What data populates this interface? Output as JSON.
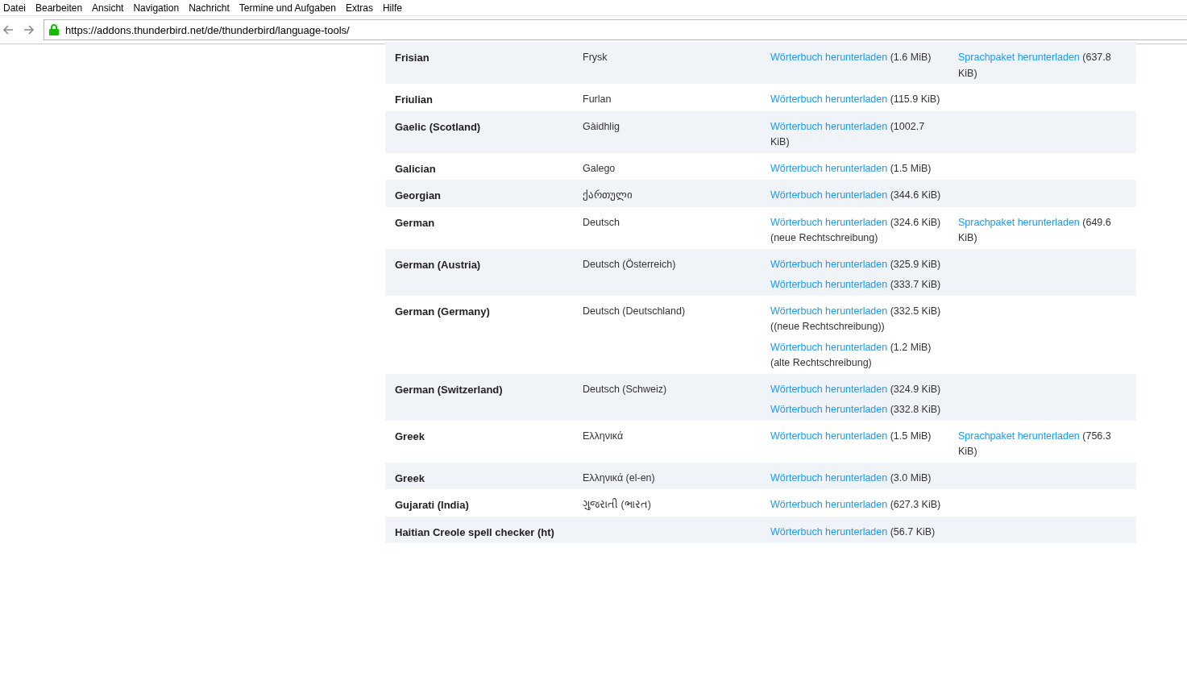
{
  "menu": [
    {
      "label": "Datei"
    },
    {
      "label": "Bearbeiten"
    },
    {
      "label": "Ansicht"
    },
    {
      "label": "Navigation"
    },
    {
      "label": "Nachricht"
    },
    {
      "label": "Termine und Aufgaben"
    },
    {
      "label": "Extras"
    },
    {
      "label": "Hilfe"
    }
  ],
  "address_bar": {
    "url": "https://addons.thunderbird.net/de/thunderbird/language-tools/",
    "secure": true
  },
  "table": {
    "rows": [
      {
        "language": "Frisian",
        "native": "Frysk",
        "dictionaries": [
          {
            "link": "Wörterbuch herunterladen",
            "size": "(1.6 MiB)"
          }
        ],
        "language_pack": {
          "link": "Sprachpaket herunterladen",
          "size": "(637.8 KiB)"
        }
      },
      {
        "language": "Friulian",
        "native": "Furlan",
        "dictionaries": [
          {
            "link": "Wörterbuch herunterladen",
            "size": "(115.9 KiB)"
          }
        ]
      },
      {
        "language": "Gaelic (Scotland)",
        "native": "Gàidhlig",
        "dictionaries": [
          {
            "link": "Wörterbuch herunterladen",
            "size": "(1002.7 KiB)"
          }
        ]
      },
      {
        "language": "Galician",
        "native": "Galego",
        "dictionaries": [
          {
            "link": "Wörterbuch herunterladen",
            "size": "(1.5 MiB)"
          }
        ]
      },
      {
        "language": "Georgian",
        "native": "ქართული",
        "dictionaries": [
          {
            "link": "Wörterbuch herunterladen",
            "size": "(344.6 KiB)"
          }
        ]
      },
      {
        "language": "German",
        "native": "Deutsch",
        "dictionaries": [
          {
            "link": "Wörterbuch herunterladen",
            "size": "(324.6 KiB)",
            "note": "(neue Rechtschreibung)"
          }
        ],
        "language_pack": {
          "link": "Sprachpaket herunterladen",
          "size": "(649.6 KiB)"
        }
      },
      {
        "language": "German (Austria)",
        "native": "Deutsch (Österreich)",
        "dictionaries": [
          {
            "link": "Wörterbuch herunterladen",
            "size": "(325.9 KiB)"
          },
          {
            "link": "Wörterbuch herunterladen",
            "size": "(333.7 KiB)"
          }
        ]
      },
      {
        "language": "German (Germany)",
        "native": "Deutsch (Deutschland)",
        "dictionaries": [
          {
            "link": "Wörterbuch herunterladen",
            "size": "(332.5 KiB)",
            "note": "((neue Rechtschreibung))"
          },
          {
            "link": "Wörterbuch herunterladen",
            "size": "(1.2 MiB)",
            "note": "(alte Rechtschreibung)"
          }
        ]
      },
      {
        "language": "German (Switzerland)",
        "native": "Deutsch (Schweiz)",
        "dictionaries": [
          {
            "link": "Wörterbuch herunterladen",
            "size": "(324.9 KiB)"
          },
          {
            "link": "Wörterbuch herunterladen",
            "size": "(332.8 KiB)"
          }
        ]
      },
      {
        "language": "Greek",
        "native": "Ελληνικά",
        "dictionaries": [
          {
            "link": "Wörterbuch herunterladen",
            "size": "(1.5 MiB)"
          }
        ],
        "language_pack": {
          "link": "Sprachpaket herunterladen",
          "size": "(756.3 KiB)"
        }
      },
      {
        "language": "Greek",
        "native": "Ελληνικά (el-en)",
        "dictionaries": [
          {
            "link": "Wörterbuch herunterladen",
            "size": "(3.0 MiB)"
          }
        ]
      },
      {
        "language": "Gujarati (India)",
        "native": "ગુજરાતી (ભારત)",
        "dictionaries": [
          {
            "link": "Wörterbuch herunterladen",
            "size": "(627.3 KiB)"
          }
        ]
      },
      {
        "language": "Haitian Creole spell checker (ht)",
        "dictionaries": [
          {
            "link": "Wörterbuch herunterladen",
            "size": "(56.7 KiB)"
          }
        ]
      }
    ]
  }
}
